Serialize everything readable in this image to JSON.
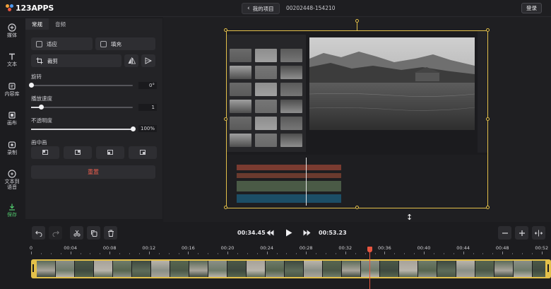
{
  "header": {
    "logo_text": "123APPS",
    "back_label": "我的项目",
    "project_id": "00202448-154210",
    "login_label": "登录"
  },
  "sidebar": {
    "items": [
      {
        "label": "媒体",
        "icon": "plus-circle-icon"
      },
      {
        "label": "文本",
        "icon": "text-icon"
      },
      {
        "label": "内容库",
        "icon": "library-icon"
      },
      {
        "label": "画布",
        "icon": "canvas-icon"
      },
      {
        "label": "录制",
        "icon": "record-icon"
      },
      {
        "label": "文本到语音",
        "icon": "text-to-speech-icon"
      },
      {
        "label": "保存",
        "icon": "download-icon"
      }
    ],
    "save_color": "#4fc36b"
  },
  "panel": {
    "tabs": [
      "常规",
      "音频"
    ],
    "active_tab": "常规",
    "fit_label": "适应",
    "fill_label": "填充",
    "crop_label": "裁剪",
    "rotation_label": "旋转",
    "rotation_value": "0°",
    "rotation_fraction": 0,
    "speed_label": "播放速度",
    "speed_value": "1",
    "speed_fraction": 0.1,
    "opacity_label": "不透明度",
    "opacity_value": "100%",
    "opacity_fraction": 1,
    "pip_label": "画中画",
    "pip_positions": [
      "top-left",
      "top-right",
      "bottom-left",
      "bottom-right"
    ],
    "reset_label": "重置",
    "reset_color": "#e85d4e"
  },
  "controls": {
    "current_time": "00:34.45",
    "total_time": "00:53.23"
  },
  "ruler": {
    "labels": [
      "0",
      "00:04",
      "00:08",
      "00:12",
      "00:16",
      "00:20",
      "00:24",
      "00:28",
      "00:32",
      "00:36",
      "00:40",
      "00:44",
      "00:48",
      "00:52"
    ],
    "playhead_seconds": 34.45
  },
  "colors": {
    "accent_selection": "#e3c04a",
    "playhead": "#e8553f"
  }
}
